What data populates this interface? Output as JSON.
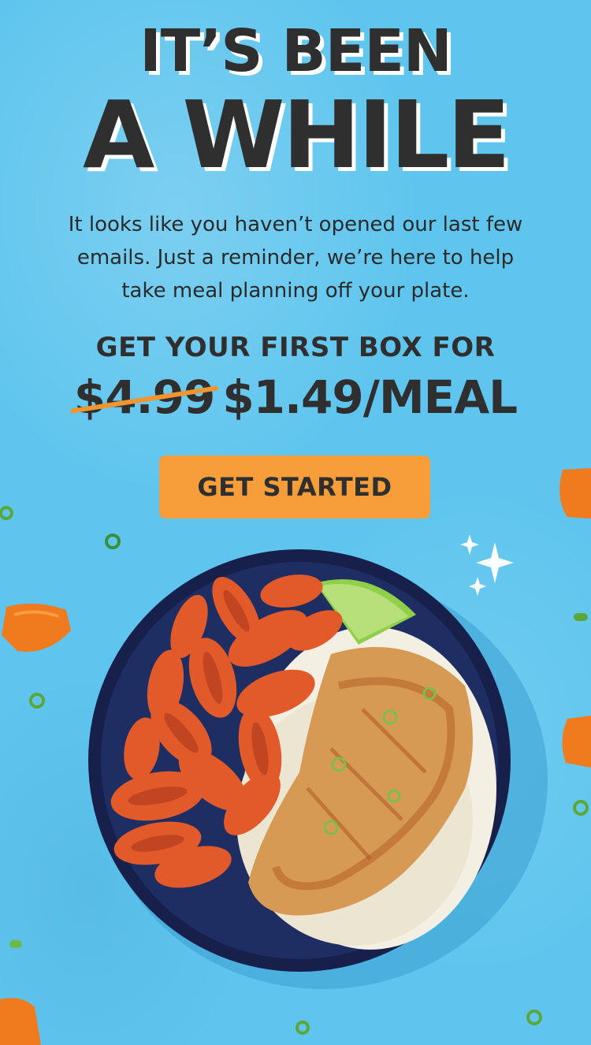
{
  "headline": {
    "line1": "IT’S BEEN",
    "line2": "A WHILE"
  },
  "body_text": {
    "line1": "It looks like you haven’t opened our last few",
    "line2": "emails. Just a reminder, we’re here to help",
    "line3": "take meal planning off your plate."
  },
  "offer": {
    "intro": "GET YOUR FIRST BOX FOR",
    "old_price": "$4.99",
    "new_price": "$1.49/MEAL"
  },
  "cta": {
    "label": "GET STARTED"
  },
  "colors": {
    "background": "#5fc5ee",
    "headline": "#2f2f2f",
    "cta": "#f79d3a",
    "strike": "#f0952f",
    "plate": "#1c2a5c"
  },
  "icons": [
    "sparkle-icon"
  ]
}
